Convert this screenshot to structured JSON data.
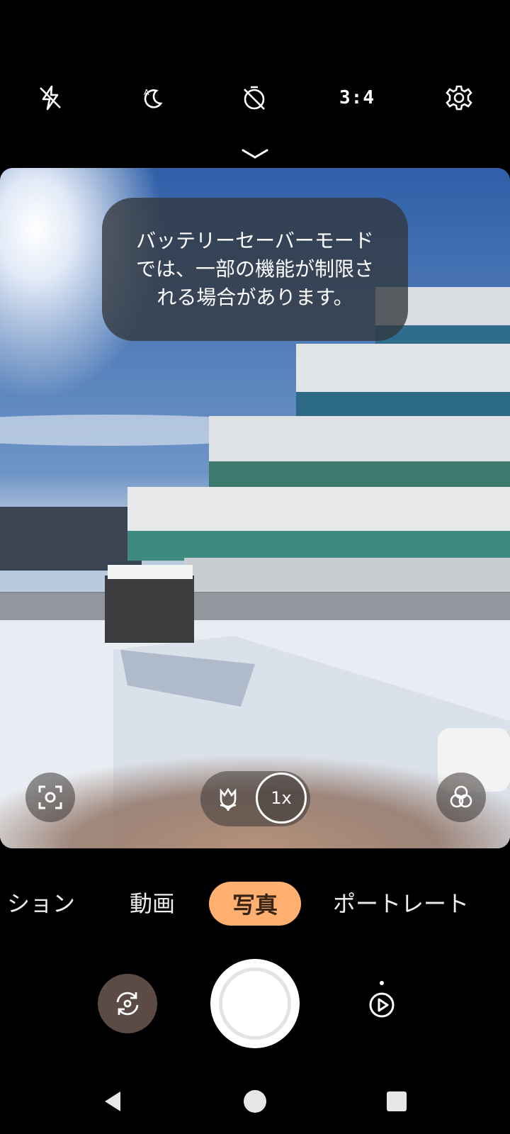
{
  "top_bar": {
    "icons": [
      "flash-off-icon",
      "auto-night-icon",
      "timer-off-icon",
      "aspect-ratio",
      "settings-icon"
    ],
    "aspect_ratio": "3:4"
  },
  "viewfinder": {
    "toast_text": "バッテリーセーバーモードでは、一部の機能が制限される場合があります。",
    "zoom_label": "1x"
  },
  "modes": {
    "items": [
      "ション",
      "動画",
      "写真",
      "ポートレート"
    ],
    "active": "写真"
  },
  "controls": {
    "switch_camera": "switch-camera-icon",
    "shutter": "shutter-button",
    "gallery": "gallery-play-icon"
  },
  "nav": [
    "back",
    "home",
    "recents"
  ]
}
